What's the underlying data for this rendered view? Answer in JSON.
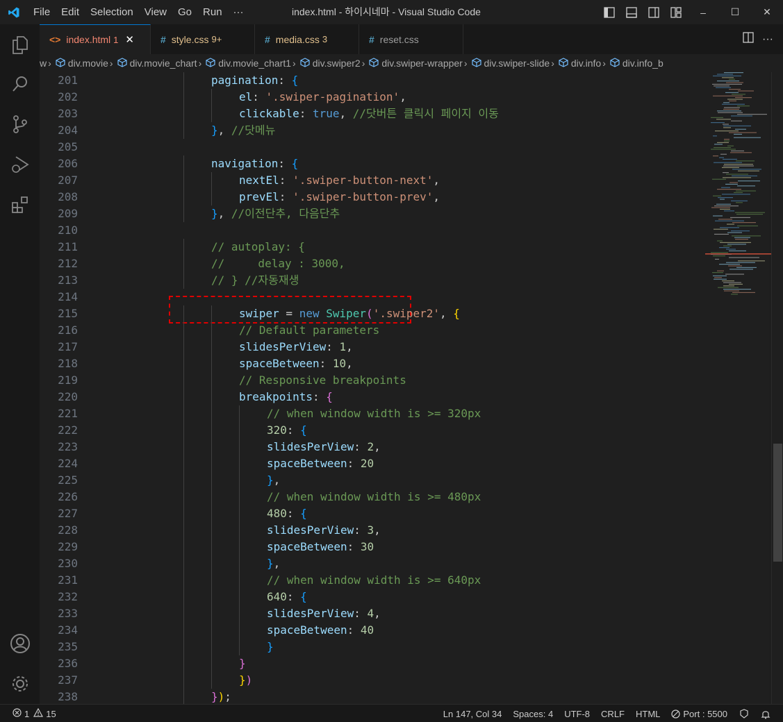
{
  "window": {
    "title": "index.html - 하이시네마 - Visual Studio Code",
    "menu": [
      "File",
      "Edit",
      "Selection",
      "View",
      "Go",
      "Run",
      "···"
    ],
    "controls": [
      "–",
      "☐",
      "✕"
    ]
  },
  "tabs": [
    {
      "icon": "<>",
      "name": "index.html",
      "badge": "1",
      "active": true,
      "color": "#f48771"
    },
    {
      "icon": "#",
      "name": "style.css",
      "badge": "9+",
      "active": false,
      "color": "#e2c08d"
    },
    {
      "icon": "#",
      "name": "media.css",
      "badge": "3",
      "active": false,
      "color": "#e2c08d"
    },
    {
      "icon": "#",
      "name": "reset.css",
      "badge": "",
      "active": false,
      "color": "#9d9d9d"
    }
  ],
  "breadcrumb": [
    "w",
    "div.movie",
    "div.movie_chart",
    "div.movie_chart1",
    "div.swiper2",
    "div.swiper-wrapper",
    "div.swiper-slide",
    "div.info",
    "div.info_b"
  ],
  "code_lines": [
    {
      "n": "201",
      "indent": 4,
      "tokens": [
        [
          "p",
          "pagination"
        ],
        [
          "w",
          ": "
        ],
        [
          "b3",
          "{"
        ]
      ]
    },
    {
      "n": "202",
      "indent": 5,
      "tokens": [
        [
          "p",
          "el"
        ],
        [
          "w",
          ": "
        ],
        [
          "s",
          "'.swiper-pagination'"
        ],
        [
          "w",
          ","
        ]
      ]
    },
    {
      "n": "203",
      "indent": 5,
      "tokens": [
        [
          "p",
          "clickable"
        ],
        [
          "w",
          ": "
        ],
        [
          "k",
          "true"
        ],
        [
          "w",
          ", "
        ],
        [
          "c",
          "//닷버튼 클릭시 페이지 이동"
        ]
      ]
    },
    {
      "n": "204",
      "indent": 4,
      "tokens": [
        [
          "b3",
          "}"
        ],
        [
          "w",
          ", "
        ],
        [
          "c",
          "//닷메뉴"
        ]
      ]
    },
    {
      "n": "205",
      "indent": 0,
      "tokens": []
    },
    {
      "n": "206",
      "indent": 4,
      "tokens": [
        [
          "p",
          "navigation"
        ],
        [
          "w",
          ": "
        ],
        [
          "b3",
          "{"
        ]
      ]
    },
    {
      "n": "207",
      "indent": 5,
      "tokens": [
        [
          "p",
          "nextEl"
        ],
        [
          "w",
          ": "
        ],
        [
          "s",
          "'.swiper-button-next'"
        ],
        [
          "w",
          ","
        ]
      ]
    },
    {
      "n": "208",
      "indent": 5,
      "tokens": [
        [
          "p",
          "prevEl"
        ],
        [
          "w",
          ": "
        ],
        [
          "s",
          "'.swiper-button-prev'"
        ],
        [
          "w",
          ","
        ]
      ]
    },
    {
      "n": "209",
      "indent": 4,
      "tokens": [
        [
          "b3",
          "}"
        ],
        [
          "w",
          ", "
        ],
        [
          "c",
          "//이전단추, 다음단추"
        ]
      ]
    },
    {
      "n": "210",
      "indent": 0,
      "tokens": []
    },
    {
      "n": "211",
      "indent": 4,
      "tokens": [
        [
          "c",
          "// autoplay: {"
        ]
      ]
    },
    {
      "n": "212",
      "indent": 4,
      "tokens": [
        [
          "c",
          "//     delay : 3000,"
        ]
      ]
    },
    {
      "n": "213",
      "indent": 4,
      "tokens": [
        [
          "c",
          "// } //자동재생"
        ]
      ]
    },
    {
      "n": "214",
      "indent": 0,
      "tokens": []
    },
    {
      "n": "215",
      "indent": 5,
      "tokens": [
        [
          "p",
          "swiper"
        ],
        [
          "w",
          " = "
        ],
        [
          "k",
          "new"
        ],
        [
          "w",
          " "
        ],
        [
          "t",
          "Swiper"
        ],
        [
          "b2",
          "("
        ],
        [
          "s",
          "'.swiper2'"
        ],
        [
          "w",
          ", "
        ],
        [
          "b1",
          "{"
        ]
      ]
    },
    {
      "n": "216",
      "indent": 5,
      "tokens": [
        [
          "c",
          "// Default parameters"
        ]
      ]
    },
    {
      "n": "217",
      "indent": 5,
      "tokens": [
        [
          "p",
          "slidesPerView"
        ],
        [
          "w",
          ": "
        ],
        [
          "n",
          "1"
        ],
        [
          "w",
          ","
        ]
      ]
    },
    {
      "n": "218",
      "indent": 5,
      "tokens": [
        [
          "p",
          "spaceBetween"
        ],
        [
          "w",
          ": "
        ],
        [
          "n",
          "10"
        ],
        [
          "w",
          ","
        ]
      ]
    },
    {
      "n": "219",
      "indent": 5,
      "tokens": [
        [
          "c",
          "// Responsive breakpoints"
        ]
      ]
    },
    {
      "n": "220",
      "indent": 5,
      "tokens": [
        [
          "p",
          "breakpoints"
        ],
        [
          "w",
          ": "
        ],
        [
          "b2",
          "{"
        ]
      ]
    },
    {
      "n": "221",
      "indent": 6,
      "tokens": [
        [
          "c",
          "// when window width is >= 320px"
        ]
      ]
    },
    {
      "n": "222",
      "indent": 6,
      "tokens": [
        [
          "n",
          "320"
        ],
        [
          "w",
          ": "
        ],
        [
          "b3",
          "{"
        ]
      ]
    },
    {
      "n": "223",
      "indent": 6,
      "tokens": [
        [
          "p",
          "slidesPerView"
        ],
        [
          "w",
          ": "
        ],
        [
          "n",
          "2"
        ],
        [
          "w",
          ","
        ]
      ]
    },
    {
      "n": "224",
      "indent": 6,
      "tokens": [
        [
          "p",
          "spaceBetween"
        ],
        [
          "w",
          ": "
        ],
        [
          "n",
          "20"
        ]
      ]
    },
    {
      "n": "225",
      "indent": 6,
      "tokens": [
        [
          "b3",
          "}"
        ],
        [
          "w",
          ","
        ]
      ]
    },
    {
      "n": "226",
      "indent": 6,
      "tokens": [
        [
          "c",
          "// when window width is >= 480px"
        ]
      ]
    },
    {
      "n": "227",
      "indent": 6,
      "tokens": [
        [
          "n",
          "480"
        ],
        [
          "w",
          ": "
        ],
        [
          "b3",
          "{"
        ]
      ]
    },
    {
      "n": "228",
      "indent": 6,
      "tokens": [
        [
          "p",
          "slidesPerView"
        ],
        [
          "w",
          ": "
        ],
        [
          "n",
          "3"
        ],
        [
          "w",
          ","
        ]
      ]
    },
    {
      "n": "229",
      "indent": 6,
      "tokens": [
        [
          "p",
          "spaceBetween"
        ],
        [
          "w",
          ": "
        ],
        [
          "n",
          "30"
        ]
      ]
    },
    {
      "n": "230",
      "indent": 6,
      "tokens": [
        [
          "b3",
          "}"
        ],
        [
          "w",
          ","
        ]
      ]
    },
    {
      "n": "231",
      "indent": 6,
      "tokens": [
        [
          "c",
          "// when window width is >= 640px"
        ]
      ]
    },
    {
      "n": "232",
      "indent": 6,
      "tokens": [
        [
          "n",
          "640"
        ],
        [
          "w",
          ": "
        ],
        [
          "b3",
          "{"
        ]
      ]
    },
    {
      "n": "233",
      "indent": 6,
      "tokens": [
        [
          "p",
          "slidesPerView"
        ],
        [
          "w",
          ": "
        ],
        [
          "n",
          "4"
        ],
        [
          "w",
          ","
        ]
      ]
    },
    {
      "n": "234",
      "indent": 6,
      "tokens": [
        [
          "p",
          "spaceBetween"
        ],
        [
          "w",
          ": "
        ],
        [
          "n",
          "40"
        ]
      ]
    },
    {
      "n": "235",
      "indent": 6,
      "tokens": [
        [
          "b3",
          "}"
        ]
      ]
    },
    {
      "n": "236",
      "indent": 5,
      "tokens": [
        [
          "b2",
          "}"
        ]
      ]
    },
    {
      "n": "237",
      "indent": 5,
      "tokens": [
        [
          "b1",
          "}"
        ],
        [
          "b2",
          ")"
        ]
      ]
    },
    {
      "n": "238",
      "indent": 4,
      "tokens": [
        [
          "b2",
          "}"
        ],
        [
          "b1",
          ")"
        ],
        [
          "w",
          ";"
        ]
      ]
    }
  ],
  "status": {
    "errors": "1",
    "warnings": "15",
    "position": "Ln 147, Col 34",
    "spaces": "Spaces: 4",
    "encoding": "UTF-8",
    "eol": "CRLF",
    "language": "HTML",
    "port": "Port : 5500"
  },
  "colors": {
    "accent": "#0078d4",
    "highlight_border": "#e00000"
  }
}
